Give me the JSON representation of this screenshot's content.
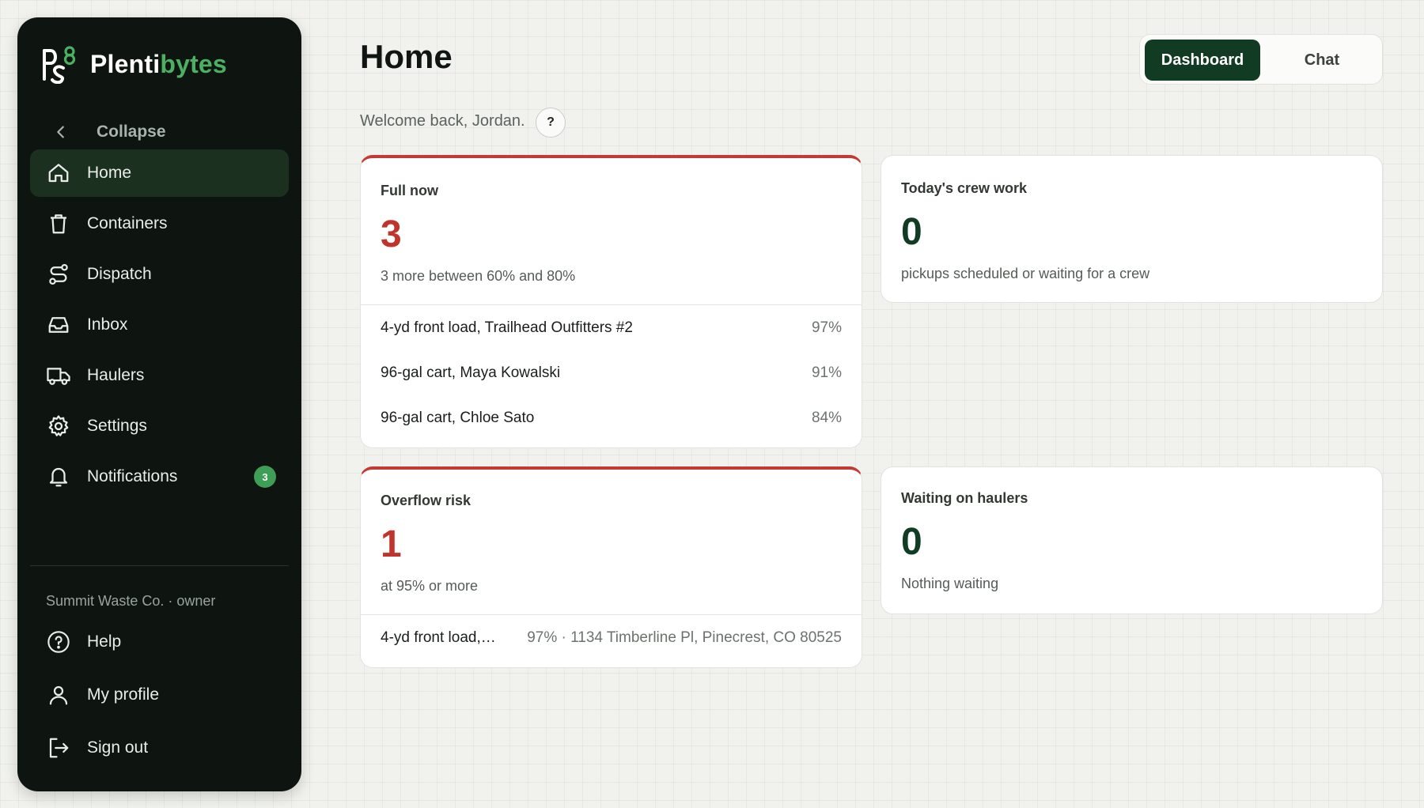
{
  "brand": {
    "name_main": "Plenti",
    "name_accent": "bytes",
    "accent_color": "#4caf62"
  },
  "sidebar": {
    "collapse_label": "Collapse",
    "items": [
      {
        "label": "Home",
        "icon": "home-icon",
        "active": true
      },
      {
        "label": "Containers",
        "icon": "trash-can-icon"
      },
      {
        "label": "Dispatch",
        "icon": "route-icon"
      },
      {
        "label": "Inbox",
        "icon": "inbox-icon"
      },
      {
        "label": "Haulers",
        "icon": "truck-icon"
      },
      {
        "label": "Settings",
        "icon": "gear-icon"
      },
      {
        "label": "Notifications",
        "icon": "bell-icon",
        "badge": "3"
      }
    ],
    "org": "Summit Waste Co. · owner",
    "bottom_items": [
      {
        "label": "Help",
        "icon": "help-circle-icon"
      },
      {
        "label": "My profile",
        "icon": "user-icon"
      },
      {
        "label": "Sign out",
        "icon": "sign-out-icon"
      }
    ]
  },
  "header": {
    "title": "Home",
    "welcome": "Welcome back, Jordan.",
    "help": "?",
    "tabs": {
      "dashboard": "Dashboard",
      "chat": "Chat"
    }
  },
  "cards": {
    "full_now": {
      "title": "Full now",
      "value": "3",
      "sub": "3 more between 60% and 80%",
      "rows": [
        {
          "name": "4-yd front load, Trailhead Outfitters #2",
          "detail": "97%"
        },
        {
          "name": "96-gal cart, Maya Kowalski",
          "detail": "91%"
        },
        {
          "name": "96-gal cart, Chloe Sato",
          "detail": "84%"
        }
      ]
    },
    "crew_work": {
      "title": "Today's crew work",
      "value": "0",
      "sub": "pickups scheduled or waiting for a crew"
    },
    "overflow": {
      "title": "Overflow risk",
      "value": "1",
      "sub": "at 95% or more",
      "rows": [
        {
          "name": "4-yd front load,…",
          "detail": "97% · 1134 Timberline Pl, Pinecrest, CO 80525"
        }
      ]
    },
    "waiting": {
      "title": "Waiting on haulers",
      "value": "0",
      "sub": "Nothing waiting"
    }
  },
  "colors": {
    "alert": "#c23a33",
    "primary_dark": "#123b24",
    "sidebar_bg": "#0e1511"
  }
}
